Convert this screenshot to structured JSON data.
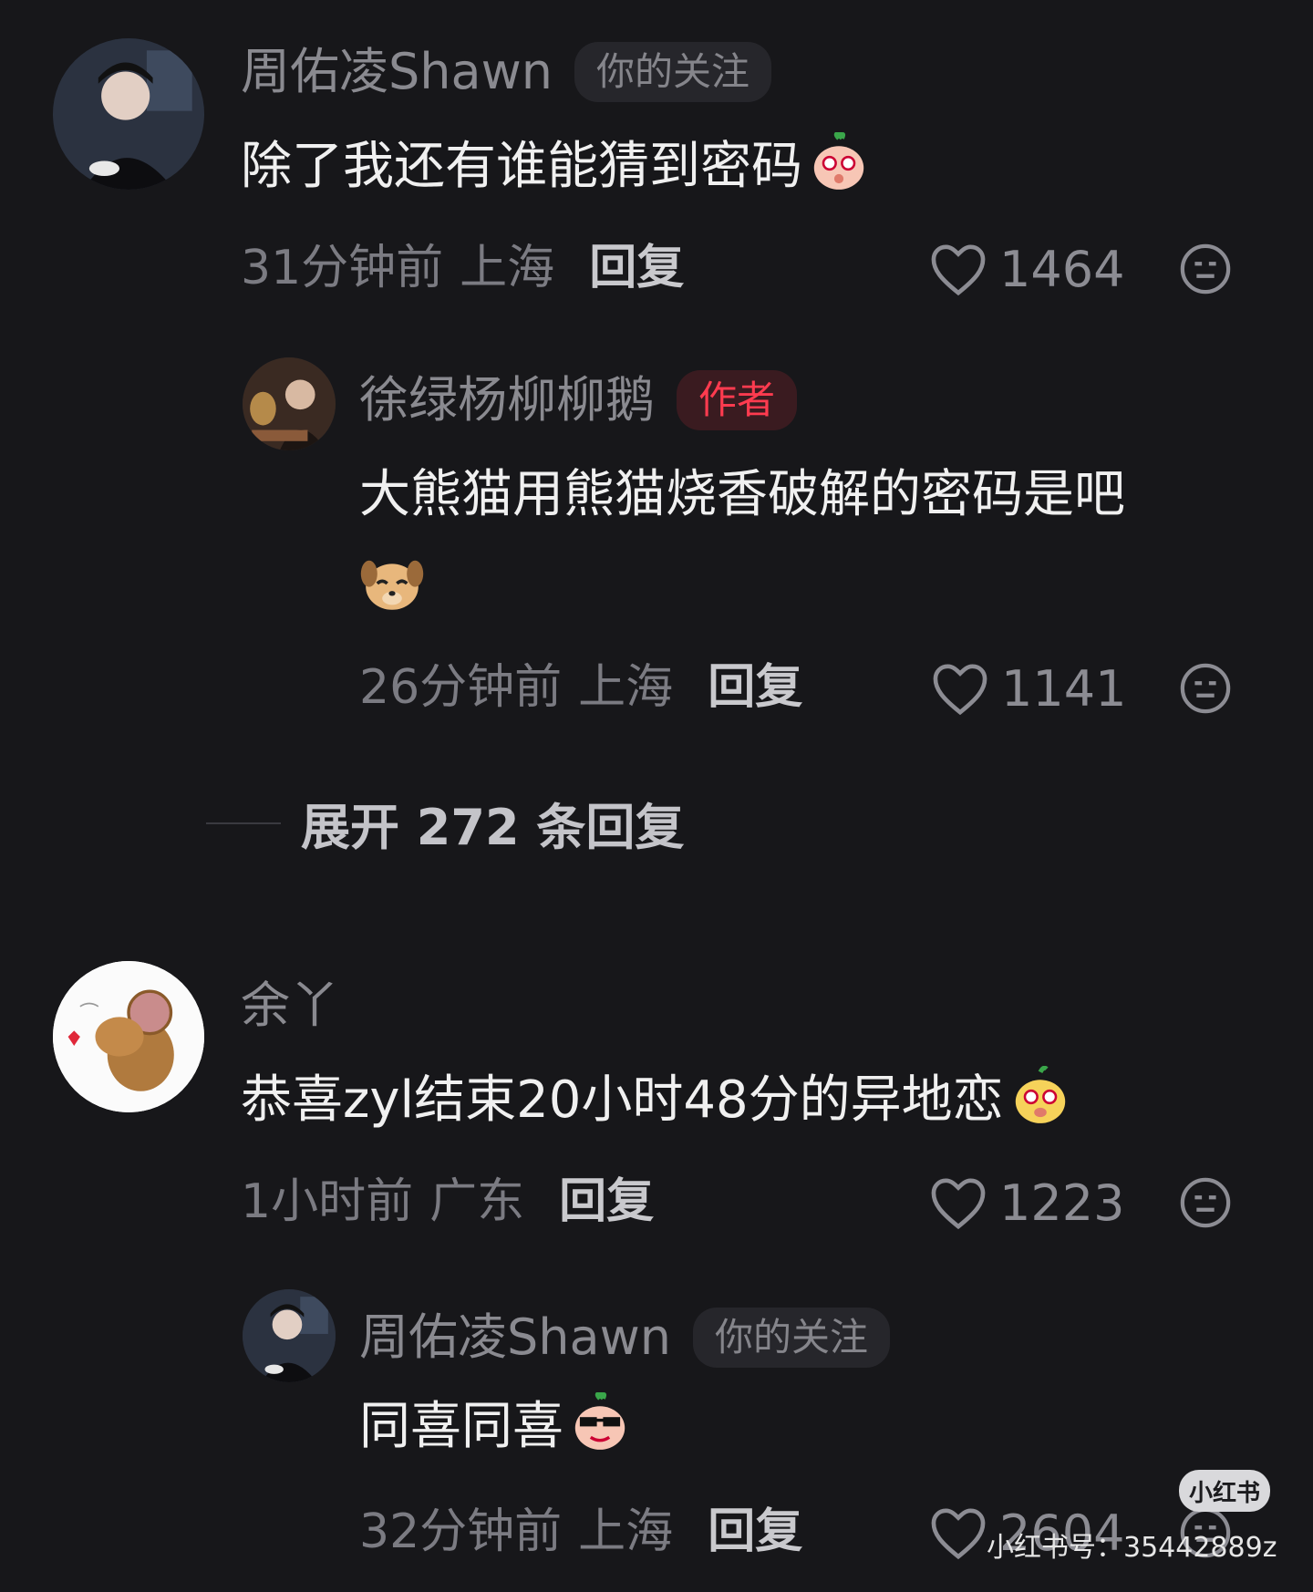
{
  "comments": [
    {
      "name": "周佑凌Shawn",
      "badge": "你的关注",
      "text": "除了我还有谁能猜到密码",
      "time": "31分钟前",
      "location": "上海",
      "reply": "回复",
      "likes": "1464"
    },
    {
      "name": "徐绿杨柳柳鹅",
      "badge": "作者",
      "text": "大熊猫用熊猫烧香破解的密码是吧",
      "time": "26分钟前",
      "location": "上海",
      "reply": "回复",
      "likes": "1141"
    },
    {
      "name": "余丫",
      "text": "恭喜zyl结束20小时48分的异地恋",
      "time": "1小时前",
      "location": "广东",
      "reply": "回复",
      "likes": "1223"
    },
    {
      "name": "周佑凌Shawn",
      "badge": "你的关注",
      "text": "同喜同喜",
      "time": "32分钟前",
      "location": "上海",
      "reply": "回复",
      "likes": "2604"
    }
  ],
  "expand_replies": "展开 272 条回复",
  "watermark": {
    "logo": "小红书",
    "id": "小红书号：35442889z"
  },
  "icons": {
    "like": "heart-outline-icon",
    "dislike": "neutral-face-icon"
  },
  "colors": {
    "background": "#17171a",
    "author_badge": "#ff3b4f"
  }
}
